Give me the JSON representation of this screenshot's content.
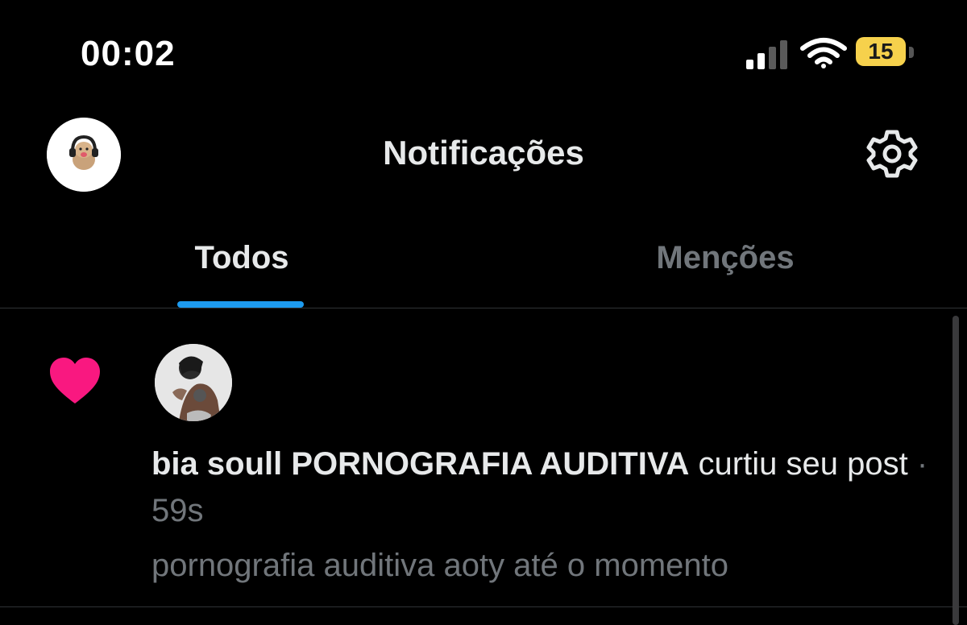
{
  "status_bar": {
    "time": "00:02",
    "battery_level": "15",
    "icons": [
      "signal-icon",
      "wifi-icon",
      "battery-icon"
    ]
  },
  "header": {
    "title": "Notificações",
    "icons": [
      "avatar",
      "gear-icon"
    ]
  },
  "tabs": [
    {
      "label": "Todos",
      "active": true
    },
    {
      "label": "Menções",
      "active": false
    }
  ],
  "notifications": [
    {
      "icon": "heart-icon",
      "user_name": "bia soull PORNOGRAFIA AUDITIVA",
      "action_part1": "curtiu seu",
      "action_part2": "post",
      "separator": "·",
      "time": "59s",
      "post_text": "pornografia auditiva aoty até o momento"
    }
  ],
  "colors": {
    "background": "#000000",
    "accent": "#1d9bf0",
    "heart": "#f91880",
    "text_primary": "#e7e9ea",
    "text_secondary": "#71767b",
    "battery": "#f6d14c"
  }
}
